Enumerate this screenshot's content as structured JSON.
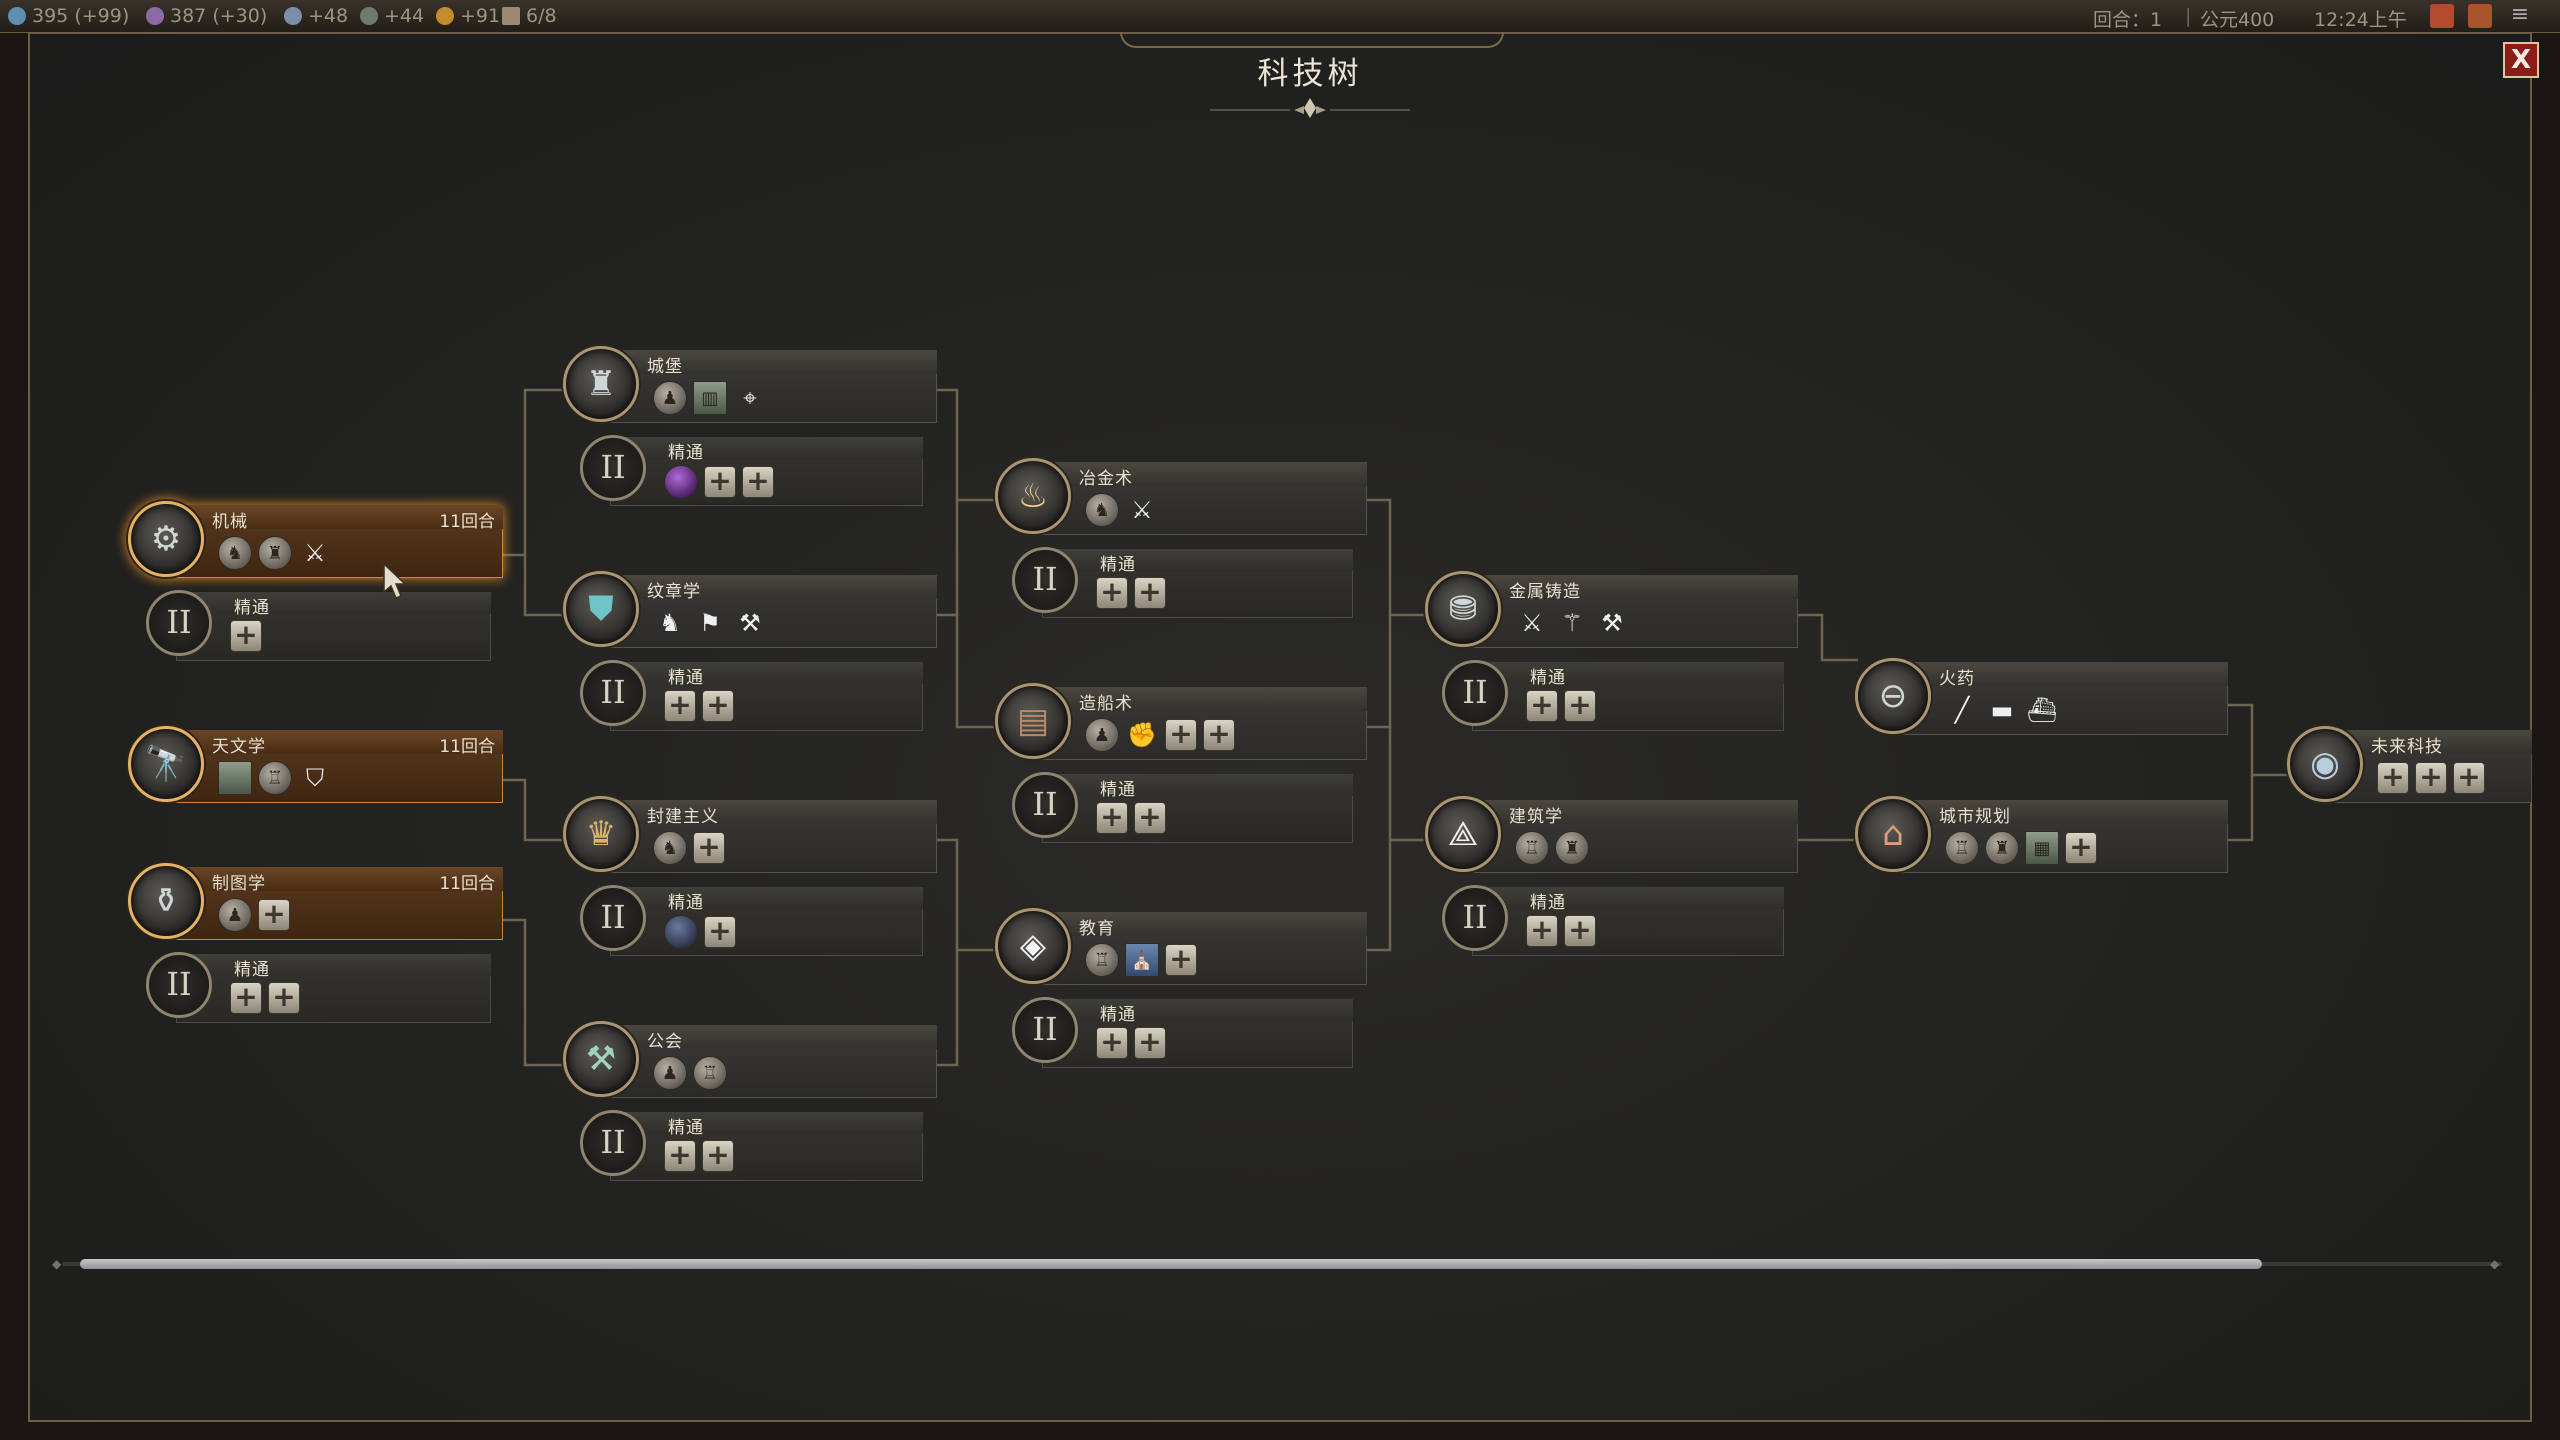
{
  "hud": {
    "science": "395",
    "science_delta": "(+99)",
    "culture": "387",
    "culture_delta": "(+30)",
    "faith": "+48",
    "tourism": "+44",
    "gold": "+91",
    "trade_routes": "6/8",
    "turn": "回合：1",
    "era": "公元400",
    "time": "12:24上午"
  },
  "title": "科技树",
  "close_label": "X",
  "mastery_label": "精通",
  "mastery_numeral": "II",
  "techs": {
    "machinery": {
      "name": "机械",
      "turns": "11回合"
    },
    "astronomy": {
      "name": "天文学",
      "turns": "11回合"
    },
    "cartography": {
      "name": "制图学",
      "turns": "11回合"
    },
    "castles": {
      "name": "城堡"
    },
    "heraldry": {
      "name": "纹章学"
    },
    "feudalism": {
      "name": "封建主义"
    },
    "guilds": {
      "name": "公会"
    },
    "metallurgy": {
      "name": "冶金术"
    },
    "shipbuilding": {
      "name": "造船术"
    },
    "education": {
      "name": "教育"
    },
    "metal_casting": {
      "name": "金属铸造"
    },
    "architecture": {
      "name": "建筑学"
    },
    "gunpowder": {
      "name": "火药"
    },
    "urban_planning": {
      "name": "城市规划"
    },
    "future_tech": {
      "name": "未来科技"
    }
  },
  "icons": {
    "machinery": "gears-icon",
    "astronomy": "telescope-icon",
    "cartography": "map-icon",
    "castles": "castle-icon",
    "heraldry": "shield-crest-icon",
    "feudalism": "crown-icon",
    "guilds": "hammer-icon",
    "metallurgy": "anvil-icon",
    "shipbuilding": "ship-hull-icon",
    "education": "mortarboard-icon",
    "metal_casting": "ingot-icon",
    "architecture": "compass-tool-icon",
    "gunpowder": "cannon-icon",
    "urban_planning": "city-icon",
    "future_tech": "globe-icon"
  },
  "colors": {
    "available_accent": "#e4b262",
    "close_button": "#8a1d17",
    "connector": "#6e6551"
  }
}
